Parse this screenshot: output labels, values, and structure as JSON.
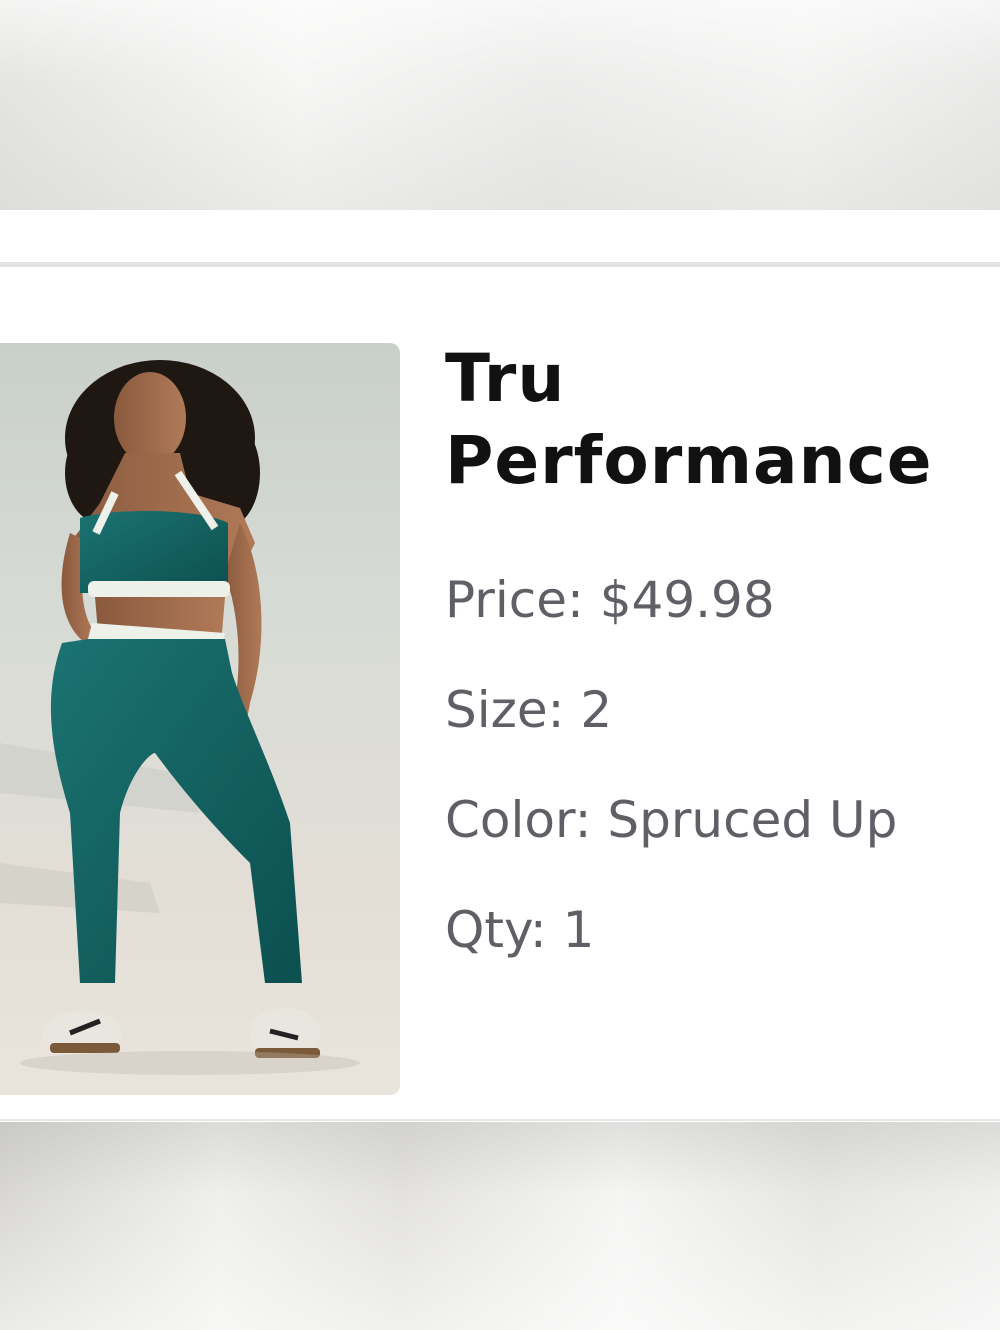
{
  "item": {
    "title_line1": "Tru",
    "title_line2": "Performance",
    "price": "Price: $49.98",
    "size": "Size: 2",
    "color": "Color: Spruced Up",
    "qty": "Qty: 1",
    "image_icon": "product-photo-icon"
  },
  "colors": {
    "title": "#111111",
    "attribute_text": "#5f6066",
    "divider": "#e2e2e2",
    "product_teal": "#11605f"
  }
}
